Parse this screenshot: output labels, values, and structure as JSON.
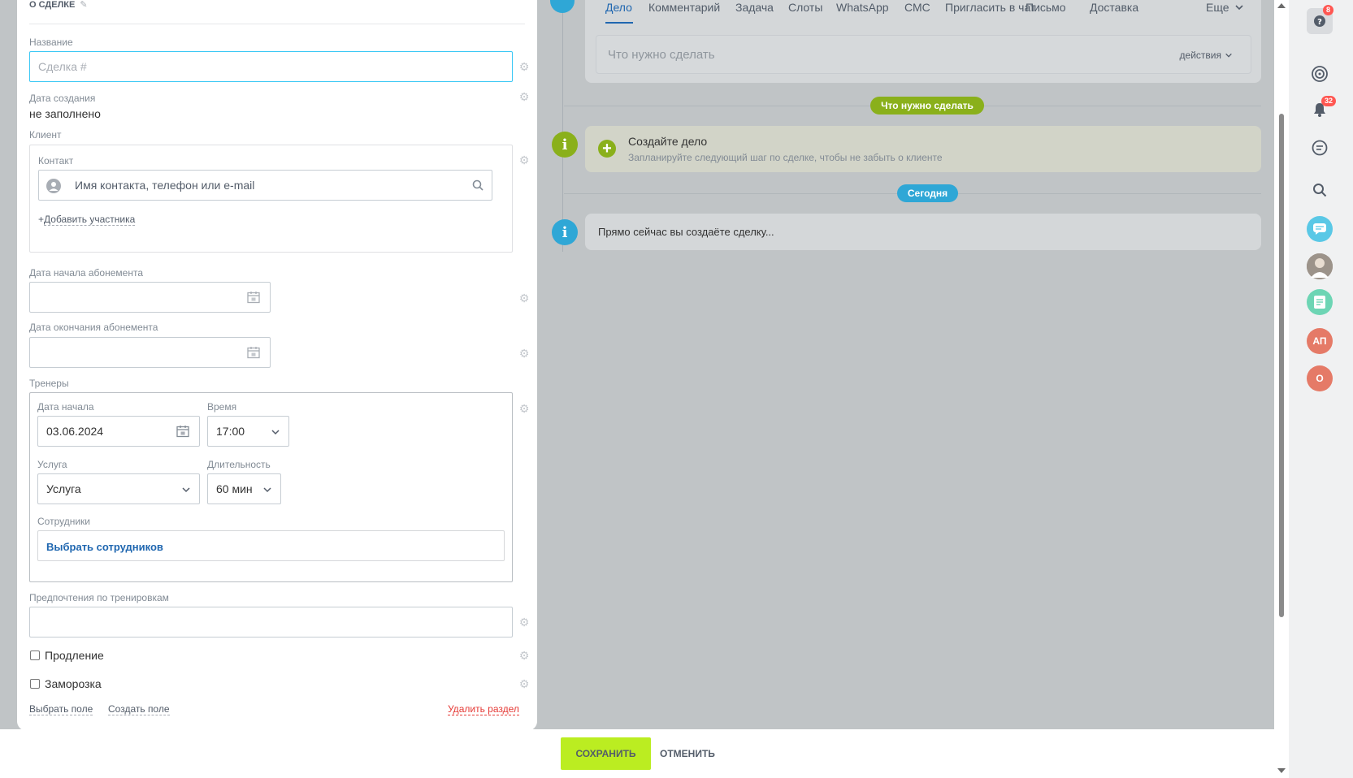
{
  "section": {
    "title": "О СДЕЛКЕ",
    "fields": {
      "name_label": "Название",
      "name_placeholder": "Сделка #",
      "created_label": "Дата создания",
      "created_value": "не заполнено",
      "client_label": "Клиент",
      "contact_label": "Контакт",
      "contact_placeholder": "Имя контакта, телефон или e-mail",
      "add_participant": "Добавить участника",
      "sub_start_label": "Дата начала абонемента",
      "sub_end_label": "Дата окончания абонемента",
      "trainers_label": "Тренеры",
      "start_date_label": "Дата начала",
      "start_date_value": "03.06.2024",
      "time_label": "Время",
      "time_value": "17:00",
      "service_label": "Услуга",
      "service_value": "Услуга",
      "duration_label": "Длительность",
      "duration_value": "60 мин",
      "staff_label": "Сотрудники",
      "staff_link": "Выбрать сотрудников",
      "prefs_label": "Предпочтения по тренировкам",
      "renewal_label": "Продление",
      "freeze_label": "Заморозка"
    },
    "footer": {
      "choose_field": "Выбрать поле",
      "create_field": "Создать поле",
      "delete_section": "Удалить раздел"
    }
  },
  "timeline": {
    "tabs": [
      "Дело",
      "Комментарий",
      "Задача",
      "Слоты",
      "WhatsApp",
      "СМС",
      "Пригласить в чат",
      "Письмо",
      "Доставка"
    ],
    "more_label": "Еще",
    "todo_placeholder": "Что нужно сделать",
    "todo_actions": "действия",
    "pill_todo": "Что нужно сделать",
    "create_title": "Создайте дело",
    "create_subtitle": "Запланируйте следующий шаг по сделке, чтобы не забыть о клиенте",
    "pill_today": "Сегодня",
    "now_text": "Прямо сейчас вы создаёте сделку..."
  },
  "actions": {
    "save": "СОХРАНИТЬ",
    "cancel": "ОТМЕНИТЬ"
  },
  "rail": {
    "help_badge": "8",
    "notif_badge": "32",
    "avatar_ap": "АП",
    "avatar_o": "О"
  },
  "colors": {
    "accent_blue": "#2067b0",
    "save_green": "#bbed21",
    "timeline_green": "#8ab01b",
    "timeline_blue": "#2fa7d6",
    "delete_red": "#e53935"
  }
}
